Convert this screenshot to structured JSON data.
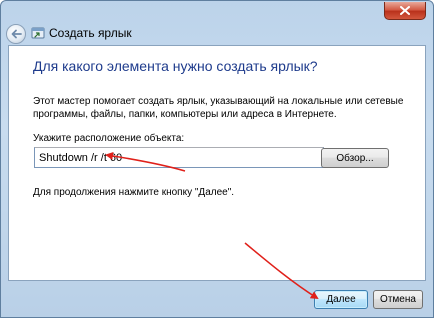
{
  "window": {
    "title": "Создать ярлык"
  },
  "wizard": {
    "heading": "Для какого элемента нужно создать ярлык?",
    "description": "Этот мастер помогает создать ярлык, указывающий на локальные или сетевые программы, файлы, папки, компьютеры или адреса в Интернете.",
    "location_label": "Укажите расположение объекта:",
    "location_value": "Shutdown /r /t 60",
    "browse_label": "Обзор...",
    "continue_hint": "Для продолжения нажмите кнопку \"Далее\"."
  },
  "footer": {
    "next_label": "Далее",
    "cancel_label": "Отмена"
  },
  "colors": {
    "heading": "#1e3b8c",
    "annotation_arrow": "#e0201a",
    "close_button": "#c9452c"
  },
  "icons": {
    "close": "close-icon",
    "back": "back-arrow-icon",
    "wizard": "shortcut-wizard-icon"
  }
}
